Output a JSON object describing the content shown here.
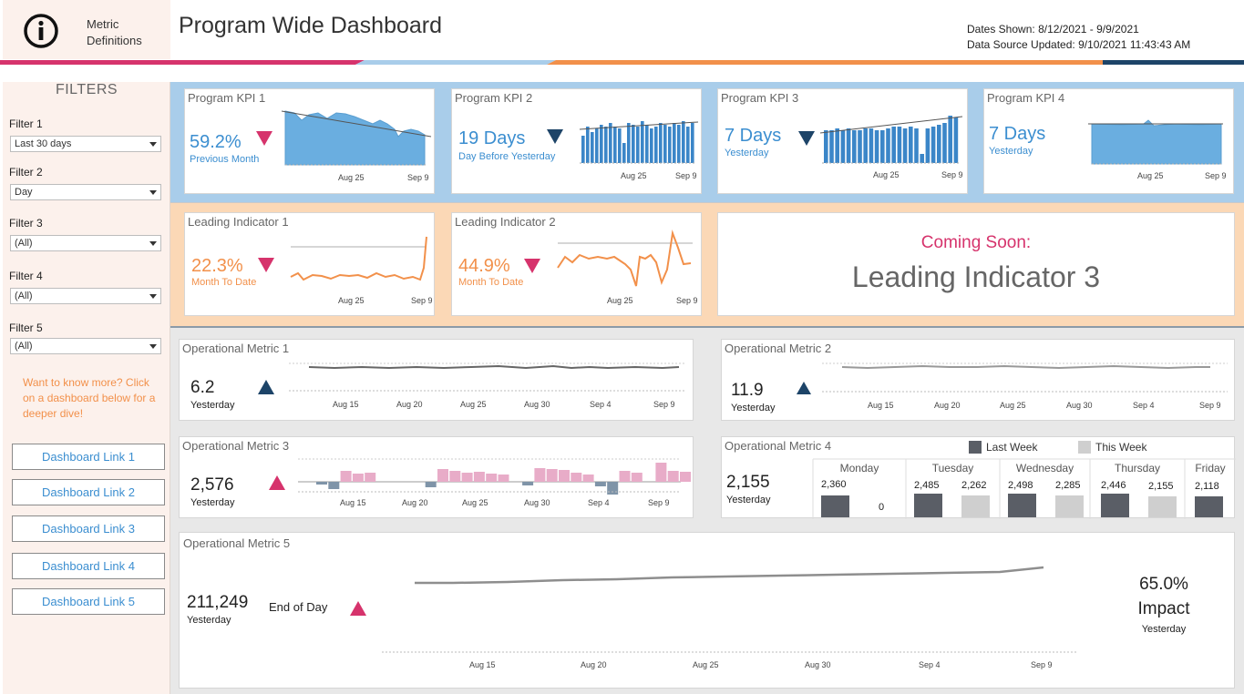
{
  "header": {
    "info_label_line1": "Metric",
    "info_label_line2": "Definitions",
    "title": "Program Wide Dashboard",
    "dates_shown_label": "Dates Shown:",
    "dates_shown_value": "8/12/2021 - 9/9/2021",
    "source_label": "Data Source Updated:",
    "source_value": "9/10/2021 11:43:43 AM"
  },
  "colors": {
    "accent_pink": "#d6336c",
    "accent_blue": "#3b8ed0",
    "accent_orange": "#f2904a",
    "navy": "#1d4468",
    "kpi_band": "#a9cdea",
    "leading_band": "#fbd8b6",
    "op_band": "#e8e8e8"
  },
  "sidebar": {
    "title": "FILTERS",
    "filters": [
      {
        "label": "Filter 1",
        "value": "Last 30 days"
      },
      {
        "label": "Filter 2",
        "value": "Day"
      },
      {
        "label": "Filter 3",
        "value": "(All)"
      },
      {
        "label": "Filter 4",
        "value": "(All)"
      },
      {
        "label": "Filter 5",
        "value": "(All)"
      }
    ],
    "more_text": "Want to know more? Click on a dashboard below for a deeper dive!",
    "links": [
      "Dashboard Link 1",
      "Dashboard Link 2",
      "Dashboard Link 3",
      "Dashboard Link 4",
      "Dashboard Link 5"
    ]
  },
  "kpis": [
    {
      "title": "Program KPI 1",
      "value": "59.2%",
      "sub": "Previous Month",
      "trend": "down",
      "trend_color": "#d6336c",
      "ticks": [
        "Aug 25",
        "Sep 9"
      ]
    },
    {
      "title": "Program KPI 2",
      "value": "19 Days",
      "sub": "Day Before Yesterday",
      "trend": "down",
      "trend_color": "#1d4468",
      "ticks": [
        "Aug 25",
        "Sep 9"
      ]
    },
    {
      "title": "Program KPI 3",
      "value": "7 Days",
      "sub": "Yesterday",
      "trend": "down",
      "trend_color": "#1d4468",
      "ticks": [
        "Aug 25",
        "Sep 9"
      ]
    },
    {
      "title": "Program KPI 4",
      "value": "7 Days",
      "sub": "Yesterday",
      "trend": "none",
      "ticks": [
        "Aug 25",
        "Sep 9"
      ]
    }
  ],
  "leading": [
    {
      "title": "Leading Indicator 1",
      "value": "22.3%",
      "sub": "Month To Date",
      "trend": "down",
      "trend_color": "#d6336c",
      "ticks": [
        "Aug 25",
        "Sep 9"
      ]
    },
    {
      "title": "Leading Indicator 2",
      "value": "44.9%",
      "sub": "Month To Date",
      "trend": "down",
      "trend_color": "#d6336c",
      "ticks": [
        "Aug 25",
        "Sep 9"
      ]
    }
  ],
  "coming_soon": {
    "label": "Coming Soon:",
    "title": "Leading Indicator 3"
  },
  "operational": {
    "m1": {
      "title": "Operational Metric 1",
      "value": "6.2",
      "sub": "Yesterday",
      "trend": "up",
      "trend_color": "#1d4468",
      "ticks": [
        "Aug 15",
        "Aug 20",
        "Aug 25",
        "Aug 30",
        "Sep 4",
        "Sep 9"
      ]
    },
    "m2": {
      "title": "Operational Metric 2",
      "value": "11.9",
      "sub": "Yesterday",
      "trend": "up",
      "trend_color": "#1d4468",
      "ticks": [
        "Aug 15",
        "Aug 20",
        "Aug 25",
        "Aug 30",
        "Sep 4",
        "Sep 9"
      ]
    },
    "m3": {
      "title": "Operational Metric 3",
      "value": "2,576",
      "sub": "Yesterday",
      "trend": "up",
      "trend_color": "#d6336c",
      "ticks": [
        "Aug 15",
        "Aug 20",
        "Aug 25",
        "Aug 30",
        "Sep 4",
        "Sep 9"
      ]
    },
    "m4": {
      "title": "Operational Metric 4",
      "value": "2,155",
      "sub": "Yesterday",
      "legend_last": "Last Week",
      "legend_this": "This Week",
      "days": [
        {
          "day": "Monday",
          "last": "2,360",
          "this": "0"
        },
        {
          "day": "Tuesday",
          "last": "2,485",
          "this": "2,262"
        },
        {
          "day": "Wednesday",
          "last": "2,498",
          "this": "2,285"
        },
        {
          "day": "Thursday",
          "last": "2,446",
          "this": "2,155"
        },
        {
          "day": "Friday",
          "last": "2,118",
          "this": ""
        }
      ]
    },
    "m5": {
      "title": "Operational Metric 5",
      "value": "211,249",
      "sub": "Yesterday",
      "label": "End of Day",
      "trend": "up",
      "trend_color": "#d6336c",
      "impact_value": "65.0%",
      "impact_label": "Impact",
      "impact_sub": "Yesterday",
      "ticks": [
        "Aug 15",
        "Aug 20",
        "Aug 25",
        "Aug 30",
        "Sep 4",
        "Sep 9"
      ]
    }
  }
}
